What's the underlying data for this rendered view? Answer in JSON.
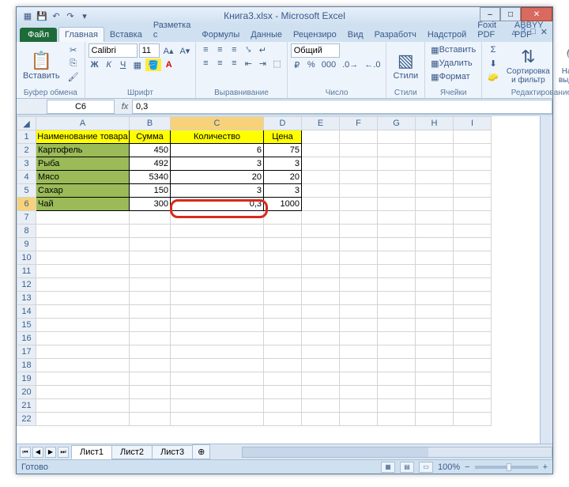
{
  "title": "Книга3.xlsx - Microsoft Excel",
  "qat": {
    "save": "💾",
    "undo": "↶",
    "redo": "↷"
  },
  "tabs": {
    "file": "Файл",
    "items": [
      "Главная",
      "Вставка",
      "Разметка с",
      "Формулы",
      "Данные",
      "Рецензиро",
      "Вид",
      "Разработч",
      "Надстрой",
      "Foxit PDF",
      "ABBYY PDF"
    ],
    "active": 0
  },
  "ribbon": {
    "clipboard": {
      "paste": "Вставить",
      "label": "Буфер обмена"
    },
    "font": {
      "name": "Calibri",
      "size": "11",
      "label": "Шрифт"
    },
    "align": {
      "label": "Выравнивание"
    },
    "number": {
      "format": "Общий",
      "label": "Число"
    },
    "styles": {
      "label": "Стили",
      "btn": "Стили"
    },
    "cells": {
      "insert": "Вставить",
      "delete": "Удалить",
      "format": "Формат",
      "label": "Ячейки"
    },
    "editing": {
      "sort": "Сортировка и фильтр",
      "find": "Найти и выделить",
      "label": "Редактирование"
    }
  },
  "formula": {
    "namebox": "C6",
    "value": "0,3"
  },
  "columns": [
    "A",
    "B",
    "C",
    "D",
    "E",
    "F",
    "G",
    "H",
    "I"
  ],
  "sheet": {
    "header": [
      "Наименование товара",
      "Сумма",
      "Количество",
      "Цена"
    ],
    "rows": [
      {
        "n": "Картофель",
        "s": "450",
        "k": "6",
        "c": "75"
      },
      {
        "n": "Рыба",
        "s": "492",
        "k": "3",
        "c": "3"
      },
      {
        "n": "Мясо",
        "s": "5340",
        "k": "20",
        "c": "20"
      },
      {
        "n": "Сахар",
        "s": "150",
        "k": "3",
        "c": "3"
      },
      {
        "n": "Чай",
        "s": "300",
        "k": "0,3",
        "c": "1000"
      }
    ],
    "selected_cell": "C6"
  },
  "sheets": {
    "items": [
      "Лист1",
      "Лист2",
      "Лист3"
    ],
    "active": 0
  },
  "status": {
    "ready": "Готово",
    "zoom": "100%"
  }
}
